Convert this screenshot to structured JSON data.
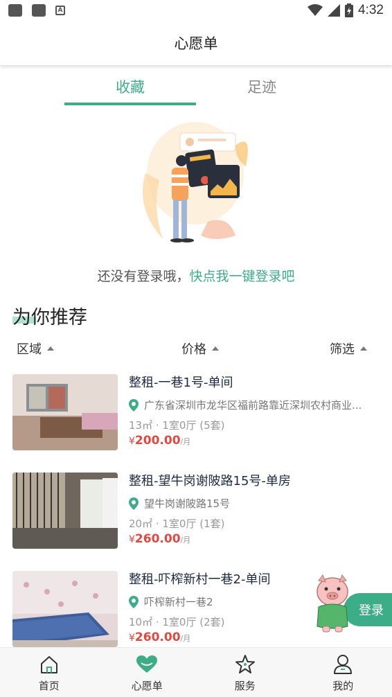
{
  "status_bar": {
    "time": "4:32"
  },
  "header": {
    "title": "心愿单"
  },
  "tabs": [
    {
      "label": "收藏",
      "active": true
    },
    {
      "label": "足迹",
      "active": false
    }
  ],
  "empty_state": {
    "prompt_text": "还没有登录哦，",
    "prompt_link": "快点我一键登录吧"
  },
  "recommend": {
    "title": "为你推荐",
    "filters": [
      {
        "label": "区域"
      },
      {
        "label": "价格"
      },
      {
        "label": "筛选"
      }
    ]
  },
  "listings": [
    {
      "title": "整租-一巷1号-单间",
      "address": "广东省深圳市龙华区福前路靠近深圳农村商业...",
      "spec": "13㎡ · 1室0厅  (5套)",
      "currency": "¥",
      "price": "200.00",
      "unit": "/月"
    },
    {
      "title": "整租-望牛岗谢陂路15号-单房",
      "address": "望牛岗谢陂路15号",
      "spec": "20㎡ · 1室0厅  (1套)",
      "currency": "¥",
      "price": "260.00",
      "unit": "/月"
    },
    {
      "title": "整租-吓榨新村一巷2-单间",
      "address": "吓榨新村一巷2",
      "spec": "10㎡ · 1室0厅  (2套)",
      "currency": "¥",
      "price": "260.00",
      "unit": "/月"
    }
  ],
  "float_login": {
    "label": "登录"
  },
  "bottom_nav": [
    {
      "label": "首页",
      "icon": "home-icon"
    },
    {
      "label": "心愿单",
      "icon": "heart-icon",
      "active": true
    },
    {
      "label": "服务",
      "icon": "star-icon"
    },
    {
      "label": "我的",
      "icon": "user-icon"
    }
  ],
  "colors": {
    "accent": "#3dad87",
    "price": "#e5473e"
  }
}
